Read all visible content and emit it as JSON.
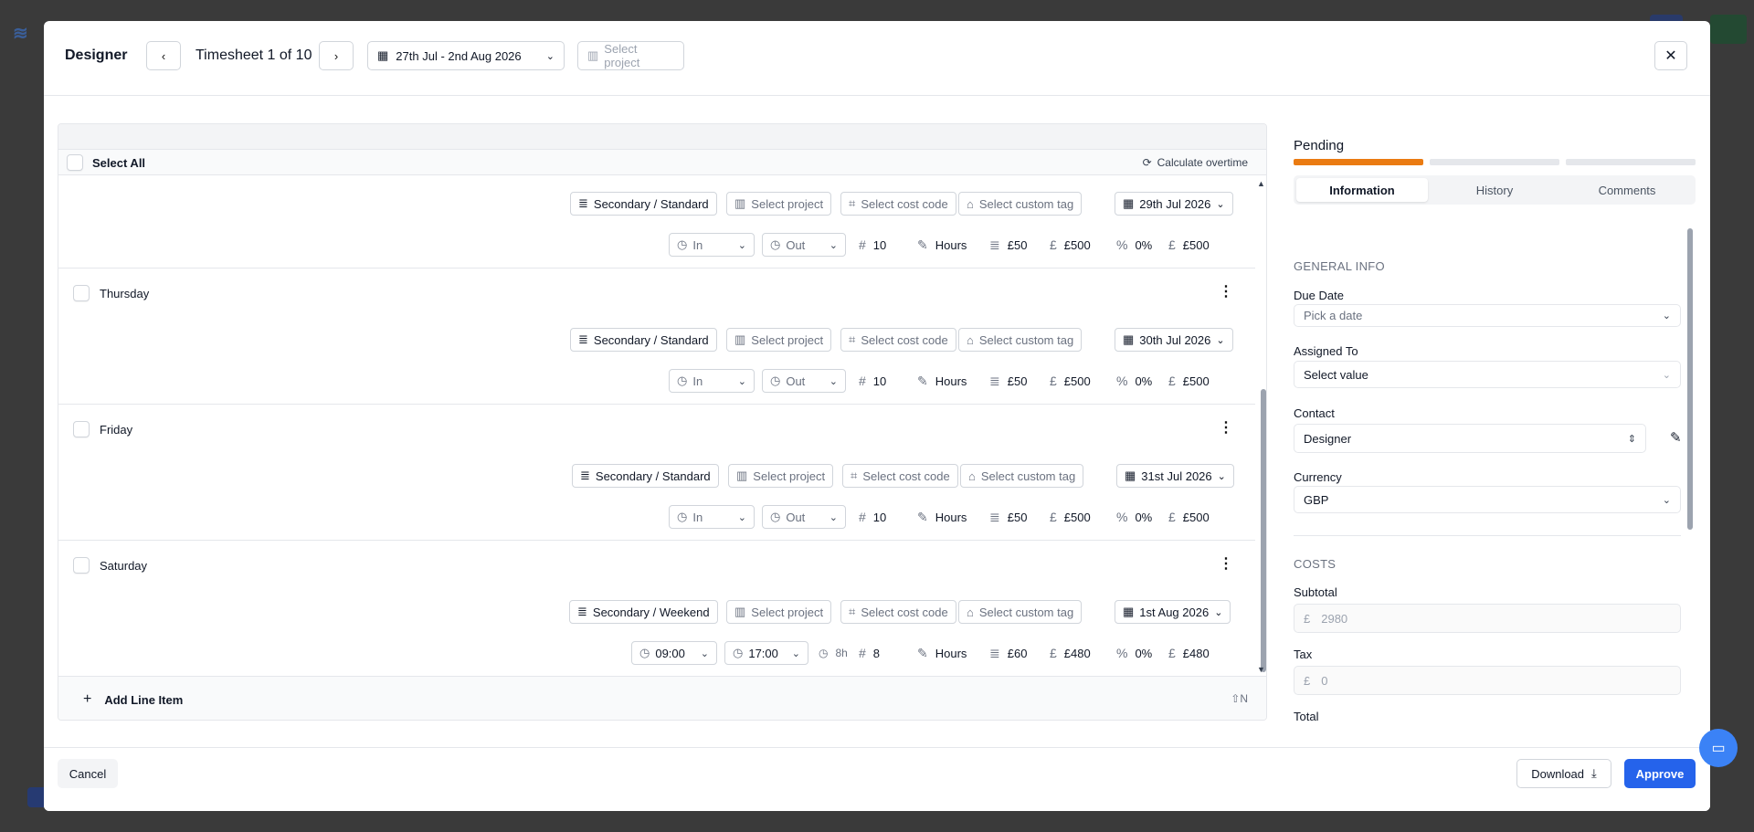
{
  "modal": {
    "title": "Designer",
    "timesheet_label": "Timesheet 1 of 10",
    "date_range": "27th Jul - 2nd Aug 2026",
    "select_project": "Select project"
  },
  "left": {
    "select_all": "Select All",
    "calculate_overtime": "Calculate overtime",
    "add_line_item": "Add Line Item",
    "shortcut": "⇧N"
  },
  "rows": [
    {
      "day": "",
      "rate_type": "Secondary / Standard",
      "project": "Select project",
      "cost_code": "Select cost code",
      "custom_tag": "Select custom tag",
      "date": "29th Jul 2026",
      "in": "In",
      "out": "Out",
      "duration": "",
      "qty": "10",
      "unit": "Hours",
      "rate": "£50",
      "amount": "£500",
      "tax": "0%",
      "total": "£500"
    },
    {
      "day": "Thursday",
      "rate_type": "Secondary / Standard",
      "project": "Select project",
      "cost_code": "Select cost code",
      "custom_tag": "Select custom tag",
      "date": "30th Jul 2026",
      "in": "In",
      "out": "Out",
      "duration": "",
      "qty": "10",
      "unit": "Hours",
      "rate": "£50",
      "amount": "£500",
      "tax": "0%",
      "total": "£500"
    },
    {
      "day": "Friday",
      "rate_type": "Secondary / Standard",
      "project": "Select project",
      "cost_code": "Select cost code",
      "custom_tag": "Select custom tag",
      "date": "31st Jul 2026",
      "in": "In",
      "out": "Out",
      "duration": "",
      "qty": "10",
      "unit": "Hours",
      "rate": "£50",
      "amount": "£500",
      "tax": "0%",
      "total": "£500"
    },
    {
      "day": "Saturday",
      "rate_type": "Secondary / Weekend",
      "project": "Select project",
      "cost_code": "Select cost code",
      "custom_tag": "Select custom tag",
      "date": "1st Aug 2026",
      "in": "09:00",
      "out": "17:00",
      "duration": "8h",
      "qty": "8",
      "unit": "Hours",
      "rate": "£60",
      "amount": "£480",
      "tax": "0%",
      "total": "£480"
    }
  ],
  "right": {
    "status": "Pending",
    "tabs": [
      "Information",
      "History",
      "Comments"
    ],
    "general_info": "GENERAL INFO",
    "due_date_label": "Due Date",
    "due_date_placeholder": "Pick a date",
    "assigned_label": "Assigned To",
    "assigned_value": "Select value",
    "contact_label": "Contact",
    "contact_value": "Designer",
    "currency_label": "Currency",
    "currency_value": "GBP",
    "costs": "COSTS",
    "subtotal_label": "Subtotal",
    "subtotal_symbol": "£",
    "subtotal_value": "2980",
    "tax_label": "Tax",
    "tax_symbol": "£",
    "tax_value": "0",
    "total_label": "Total"
  },
  "footer": {
    "cancel": "Cancel",
    "download": "Download",
    "approve": "Approve"
  },
  "colors": {
    "accent": "#2563eb",
    "progress": "#ea7b12"
  }
}
